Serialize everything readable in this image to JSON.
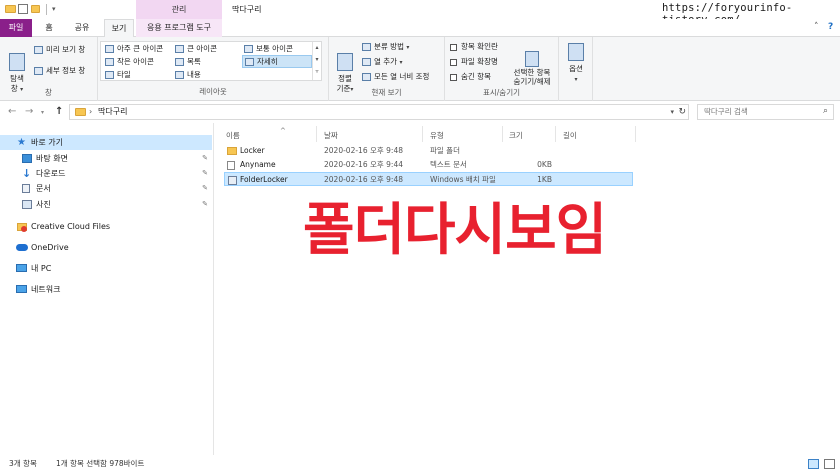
{
  "window": {
    "title": "딱다구리",
    "contextual_tab_group": "관리",
    "watermark": "https://foryourinfo-tistory.com/",
    "controls": {
      "minimize": "—",
      "maximize": "□",
      "close": "✕"
    }
  },
  "ribbon_tabs": {
    "file": "파일",
    "home": "홈",
    "share": "공유",
    "view": "보기",
    "app_tools": "응용 프로그램 도구"
  },
  "ribbon": {
    "panes_group": {
      "label": "창",
      "nav_pane": "탐색\n창",
      "preview_pane": "미리 보기 창",
      "details_pane": "세부 정보 창"
    },
    "layout_group": {
      "label": "레이아웃",
      "items": [
        "아주 큰 아이콘",
        "큰 아이콘",
        "보통 아이콘",
        "작은 아이콘",
        "목록",
        "자세히",
        "타일",
        "내용"
      ],
      "selected": "자세히"
    },
    "current_view_group": {
      "label": "현재 보기",
      "sort": "정렬\n기준",
      "group_by": "분류 방법",
      "add_columns": "열 추가",
      "size_all_columns": "모든 열 너비 조정"
    },
    "show_hide_group": {
      "label": "표시/숨기기",
      "item_checkboxes": "항목 확인란",
      "file_extensions": "파일 확장명",
      "hidden_items": "숨긴 항목",
      "hide_selected": "선택한 항목\n숨기기/해제"
    },
    "options": "옵션"
  },
  "address": {
    "path": "딱다구리",
    "separator": "›",
    "search_placeholder": "딱다구리 검색"
  },
  "nav": {
    "quick_access": "바로 가기",
    "items": [
      {
        "label": "바탕 화면",
        "pinned": true
      },
      {
        "label": "다운로드",
        "pinned": true
      },
      {
        "label": "문서",
        "pinned": true
      },
      {
        "label": "사진",
        "pinned": true
      }
    ],
    "creative_cloud": "Creative Cloud Files",
    "onedrive": "OneDrive",
    "this_pc": "내 PC",
    "network": "네트워크"
  },
  "columns": {
    "name": "이름",
    "date": "날짜",
    "type": "유형",
    "size": "크기",
    "length": "길이"
  },
  "files": [
    {
      "name": "Locker",
      "date": "2020-02-16 오후 9:48",
      "type": "파일 폴더",
      "size": "",
      "kind": "folder",
      "selected": false
    },
    {
      "name": "Anyname",
      "date": "2020-02-16 오후 9:44",
      "type": "텍스트 문서",
      "size": "0KB",
      "kind": "text",
      "selected": false
    },
    {
      "name": "FolderLocker",
      "date": "2020-02-16 오후 9:48",
      "type": "Windows 배치 파일",
      "size": "1KB",
      "kind": "batch",
      "selected": true
    }
  ],
  "overlay_caption": "폴더다시보임",
  "status": {
    "item_count": "3개 항목",
    "selection": "1개 항목 선택함 978바이트"
  },
  "colors": {
    "file_tab": "#8a1f8a",
    "manage_tab": "#f2d7f2",
    "selection": "#cce8ff",
    "overlay_red": "#e8212f",
    "folder_yellow": "#f7c652"
  }
}
